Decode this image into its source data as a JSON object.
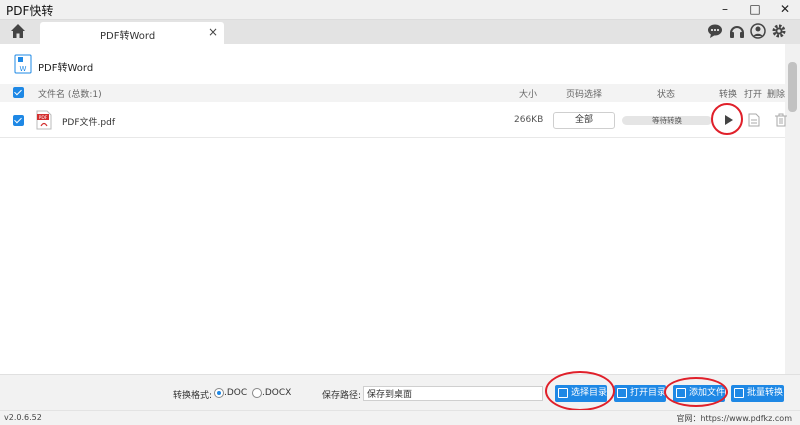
{
  "app": {
    "title": "PDF快转"
  },
  "window_controls": {
    "minimize": "–",
    "maximize": "□",
    "close": "✕"
  },
  "tab": {
    "label": "PDF转Word",
    "close": "×"
  },
  "top_icons": [
    "chat-icon",
    "headset-icon",
    "user-icon",
    "gear-icon"
  ],
  "page": {
    "title": "PDF转Word"
  },
  "table": {
    "headers": {
      "filename": "文件名 (总数:1)",
      "size": "大小",
      "pages": "页码选择",
      "status": "状态",
      "convert": "转换",
      "open": "打开",
      "delete": "删除"
    },
    "rows": [
      {
        "filename": "PDF文件.pdf",
        "size": "266KB",
        "pages": "全部",
        "status": "等待转换",
        "checked": true
      }
    ]
  },
  "bottom": {
    "format_label": "转换格式:",
    "format_options": [
      ".DOC",
      ".DOCX"
    ],
    "format_selected": ".DOC",
    "save_label": "保存路径:",
    "save_path": "保存到桌面",
    "btn_select_dir": "选择目录",
    "btn_open_dir": "打开目录",
    "btn_add_file": "添加文件",
    "btn_batch": "批量转换"
  },
  "status": {
    "version": "v2.0.6.52",
    "website": "官网：https://www.pdfkz.com"
  },
  "colors": {
    "accent": "#1e88e5",
    "highlight_ring": "#e0202a",
    "pdf_red": "#d32f2f"
  }
}
